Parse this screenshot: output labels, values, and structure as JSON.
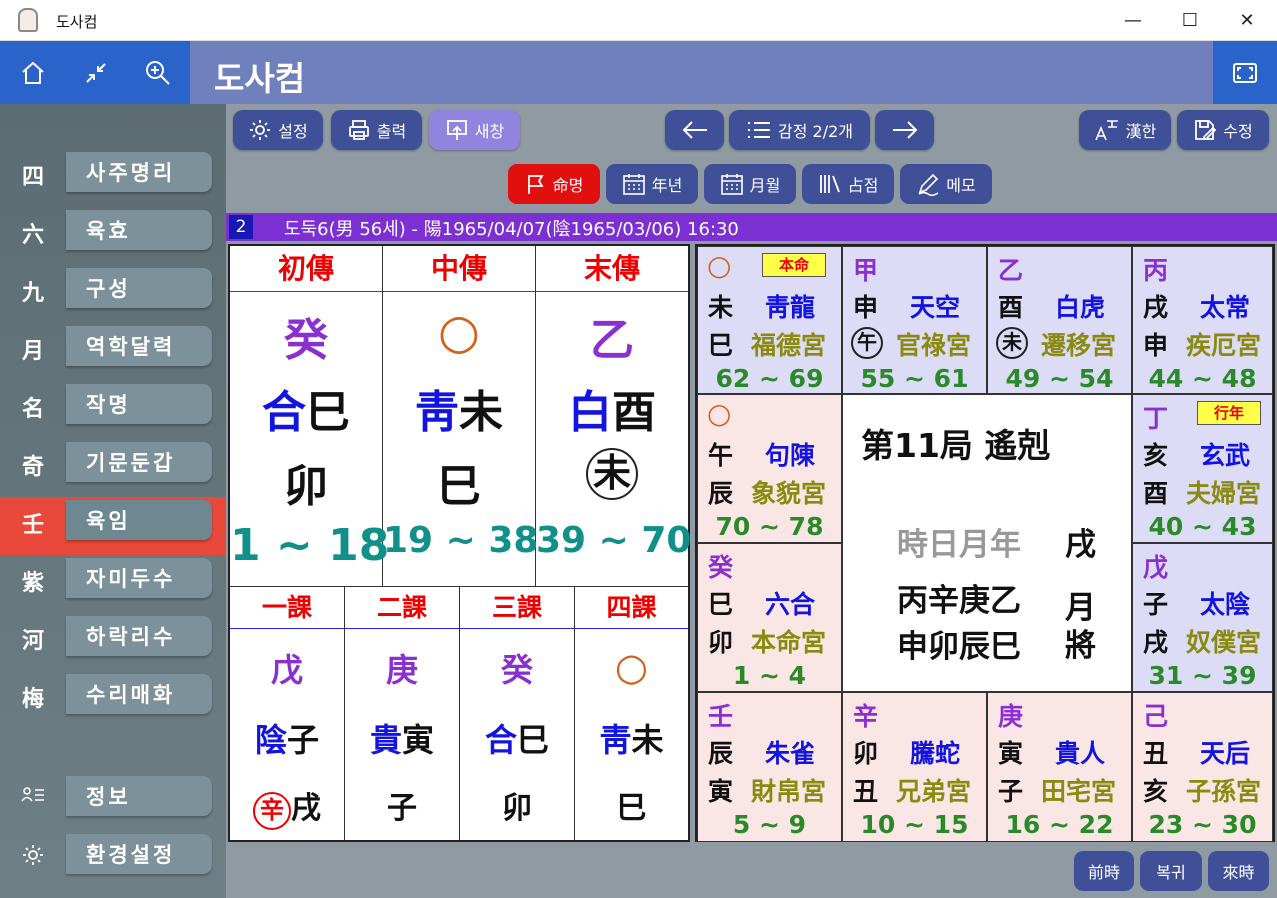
{
  "window": {
    "title": "도사컴",
    "minimize": "—",
    "maximize": "☐",
    "close": "✕"
  },
  "header": {
    "title": "도사컴",
    "home_icon": "home-icon",
    "collapse_icon": "collapse-icon",
    "zoom_icon": "zoom-icon",
    "fullscreen_icon": "fullscreen-icon"
  },
  "sidebar": {
    "items": [
      {
        "char": "四",
        "label": "사주명리"
      },
      {
        "char": "六",
        "label": "육효"
      },
      {
        "char": "九",
        "label": "구성"
      },
      {
        "char": "月",
        "label": "역학달력"
      },
      {
        "char": "名",
        "label": "작명"
      },
      {
        "char": "奇",
        "label": "기문둔갑"
      },
      {
        "char": "壬",
        "label": "육임"
      },
      {
        "char": "紫",
        "label": "자미두수"
      },
      {
        "char": "河",
        "label": "하락리수"
      },
      {
        "char": "梅",
        "label": "수리매화"
      }
    ],
    "info_label": "정보",
    "settings_label": "환경설정"
  },
  "toolbar": {
    "settings": "설정",
    "print": "출력",
    "new_window": "새창",
    "record": "감정 2/2개",
    "hanja": "漢한",
    "edit": "수정"
  },
  "tabs": [
    "命명",
    "年년",
    "月월",
    "占점",
    "메모"
  ],
  "info": {
    "number": "2",
    "text": "도둑6(男 56세) - 陽1965/04/07(陰1965/03/06) 16:30"
  },
  "left": {
    "transmissions": [
      {
        "head": "初傳",
        "top": "癸",
        "mid_a": "合",
        "mid_b": "巳",
        "bot": "卯",
        "range": "1 ~ 18"
      },
      {
        "head": "中傳",
        "top": "○",
        "mid_a": "靑",
        "mid_b": "未",
        "bot": "巳",
        "range": "19 ~ 38"
      },
      {
        "head": "末傳",
        "top": "乙",
        "mid_a": "白",
        "mid_b": "酉",
        "bot": "未",
        "range": "39 ~ 70"
      }
    ],
    "lessons": [
      {
        "head": "一課",
        "top": "戊",
        "mid_a": "陰",
        "mid_b": "子",
        "bot_a": "辛",
        "bot_b": "戌"
      },
      {
        "head": "二課",
        "top": "庚",
        "mid_a": "貴",
        "mid_b": "寅",
        "bot_a": "",
        "bot_b": "子"
      },
      {
        "head": "三課",
        "top": "癸",
        "mid_a": "合",
        "mid_b": "巳",
        "bot_a": "",
        "bot_b": "卯"
      },
      {
        "head": "四課",
        "top": "○",
        "mid_a": "靑",
        "mid_b": "未",
        "bot_a": "",
        "bot_b": "巳"
      }
    ]
  },
  "palaces": {
    "top": [
      {
        "stem": "○",
        "badge": "本命",
        "b1": "未",
        "g": "靑龍",
        "b2": "巳",
        "house": "福德宮",
        "range": "62 ~ 69"
      },
      {
        "stem": "甲",
        "badge": "",
        "b1": "申",
        "g": "天空",
        "b2": "午",
        "house": "官祿宮",
        "range": "55 ~ 61"
      },
      {
        "stem": "乙",
        "badge": "",
        "b1": "酉",
        "g": "白虎",
        "b2": "未",
        "house": "遷移宮",
        "range": "49 ~ 54"
      },
      {
        "stem": "丙",
        "badge": "",
        "b1": "戌",
        "g": "太常",
        "b2": "申",
        "house": "疾厄宮",
        "range": "44 ~ 48"
      }
    ],
    "left": [
      {
        "stem": "○",
        "b1": "午",
        "g": "句陳",
        "b2": "辰",
        "house": "象貌宮",
        "range": "70 ~ 78"
      },
      {
        "stem": "癸",
        "b1": "巳",
        "g": "六合",
        "b2": "卯",
        "house": "本命宮",
        "range": "1 ~ 4"
      }
    ],
    "right": [
      {
        "stem": "丁",
        "badge": "行年",
        "b1": "亥",
        "g": "玄武",
        "b2": "酉",
        "house": "夫婦宮",
        "range": "40 ~ 43"
      },
      {
        "stem": "戊",
        "badge": "",
        "b1": "子",
        "g": "太陰",
        "b2": "戌",
        "house": "奴僕宮",
        "range": "31 ~ 39"
      }
    ],
    "bottom": [
      {
        "stem": "壬",
        "b1": "辰",
        "g": "朱雀",
        "b2": "寅",
        "house": "財帛宮",
        "range": "5 ~ 9"
      },
      {
        "stem": "辛",
        "b1": "卯",
        "g": "騰蛇",
        "b2": "丑",
        "house": "兄弟宮",
        "range": "10 ~ 15"
      },
      {
        "stem": "庚",
        "b1": "寅",
        "g": "貴人",
        "b2": "子",
        "house": "田宅宮",
        "range": "16 ~ 22"
      },
      {
        "stem": "己",
        "b1": "丑",
        "g": "天后",
        "b2": "亥",
        "house": "子孫宮",
        "range": "23 ~ 30"
      }
    ],
    "center": {
      "title": "第11局  遙剋",
      "label": "時日月年",
      "label_right": "戌",
      "row1": "丙辛庚乙",
      "row2": "申卯辰巳",
      "side": "月將"
    }
  },
  "footer": {
    "prev": "前時",
    "reset": "복귀",
    "next": "來時"
  }
}
